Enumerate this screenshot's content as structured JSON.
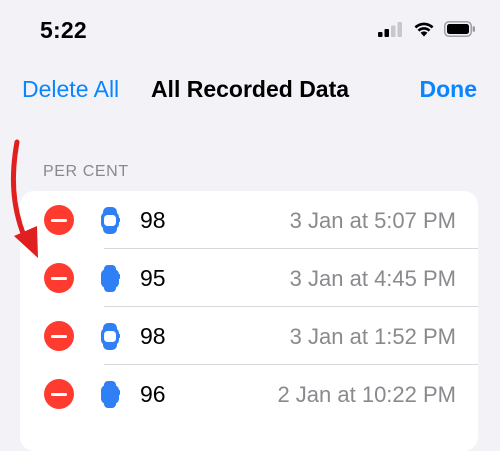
{
  "status_bar": {
    "time": "5:22",
    "icons": [
      "cellular-signal-icon",
      "wifi-icon",
      "battery-icon"
    ]
  },
  "nav": {
    "left_label": "Delete All",
    "title": "All Recorded Data",
    "right_label": "Done"
  },
  "section": {
    "header": "PER CENT"
  },
  "rows": [
    {
      "value": "98",
      "datetime": "3 Jan at 5:07 PM",
      "device": "watch-outline-icon"
    },
    {
      "value": "95",
      "datetime": "3 Jan at 4:45 PM",
      "device": "watch-filled-icon"
    },
    {
      "value": "98",
      "datetime": "3 Jan at 1:52 PM",
      "device": "watch-outline-icon"
    },
    {
      "value": "96",
      "datetime": "2 Jan at 10:22 PM",
      "device": "watch-filled-icon"
    }
  ],
  "colors": {
    "accent": "#0a84ff",
    "delete": "#ff3b30",
    "annotation_arrow": "#e02020",
    "background": "#f2f2f7",
    "secondary_text": "#8a8a8e"
  }
}
